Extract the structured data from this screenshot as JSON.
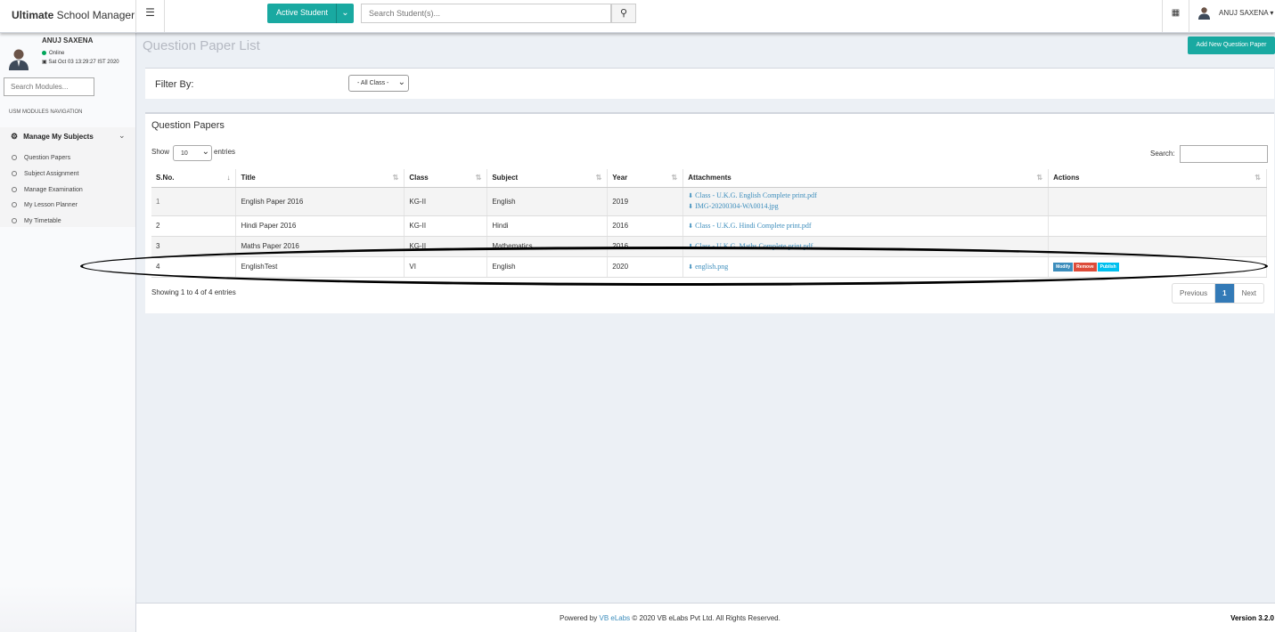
{
  "app": {
    "brand_bold": "Ultimate",
    "brand_rest": " School Manager"
  },
  "topbar": {
    "active_student_label": "Active Student",
    "search_placeholder": "Search Student(s)...",
    "user_name": "ANUJ SAXENA"
  },
  "sidebar": {
    "user_name": "ANUJ SAXENA",
    "status": "Online",
    "datetime": "Sat Oct 03 13:29:27 IST 2020",
    "search_placeholder": "Search Modules...",
    "nav_heading": "USM MODULES NAVIGATION",
    "group_title": "Manage My Subjects",
    "items": [
      "Question Papers",
      "Subject Assignment",
      "Manage Examination",
      "My Lesson Planner",
      "My Timetable"
    ]
  },
  "page": {
    "title": "Question Paper List",
    "add_button": "Add New Question Paper",
    "filter_label": "Filter By:",
    "filter_value": "- All Class -"
  },
  "table_box": {
    "title": "Question Papers",
    "show": "Show",
    "length_value": "10",
    "entries": "entries",
    "search_label": "Search:",
    "columns": [
      "S.No.",
      "Title",
      "Class",
      "Subject",
      "Year",
      "Attachments",
      "Actions"
    ],
    "rows": [
      {
        "sno": "1",
        "title": "English Paper 2016",
        "class": "KG-II",
        "subject": "English",
        "year": "2019",
        "attachments": [
          "Class - U.K.G. English Complete print.pdf",
          "IMG-20200304-WA0014.jpg"
        ]
      },
      {
        "sno": "2",
        "title": "Hindi Paper 2016",
        "class": "KG-II",
        "subject": "Hindi",
        "year": "2016",
        "attachments": [
          "Class - U.K.G. Hindi Complete print.pdf"
        ]
      },
      {
        "sno": "3",
        "title": "Maths Paper 2016",
        "class": "KG-II",
        "subject": "Mathematics",
        "year": "2016",
        "attachments": [
          "Class - U.K.G. Maths Complete print.pdf"
        ]
      },
      {
        "sno": "4",
        "title": "EnglishTest",
        "class": "VI",
        "subject": "English",
        "year": "2020",
        "attachments": [
          "english.png"
        ],
        "actions": [
          "Modify",
          "Remove",
          "Publish"
        ]
      }
    ],
    "info": "Showing 1 to 4 of 4 entries",
    "pager": {
      "previous": "Previous",
      "current": "1",
      "next": "Next"
    }
  },
  "footer": {
    "powered_by": "Powered by",
    "company_link": "VB eLabs",
    "copyright": "© 2020 VB eLabs Pvt Ltd. All Rights Reserved.",
    "version": "Version 3.2.0"
  },
  "colors": {
    "accent": "#19a9a1",
    "link": "#3c8dbc",
    "remove": "#dd4b39",
    "publish": "#00c0ef",
    "online": "#00a65a"
  }
}
